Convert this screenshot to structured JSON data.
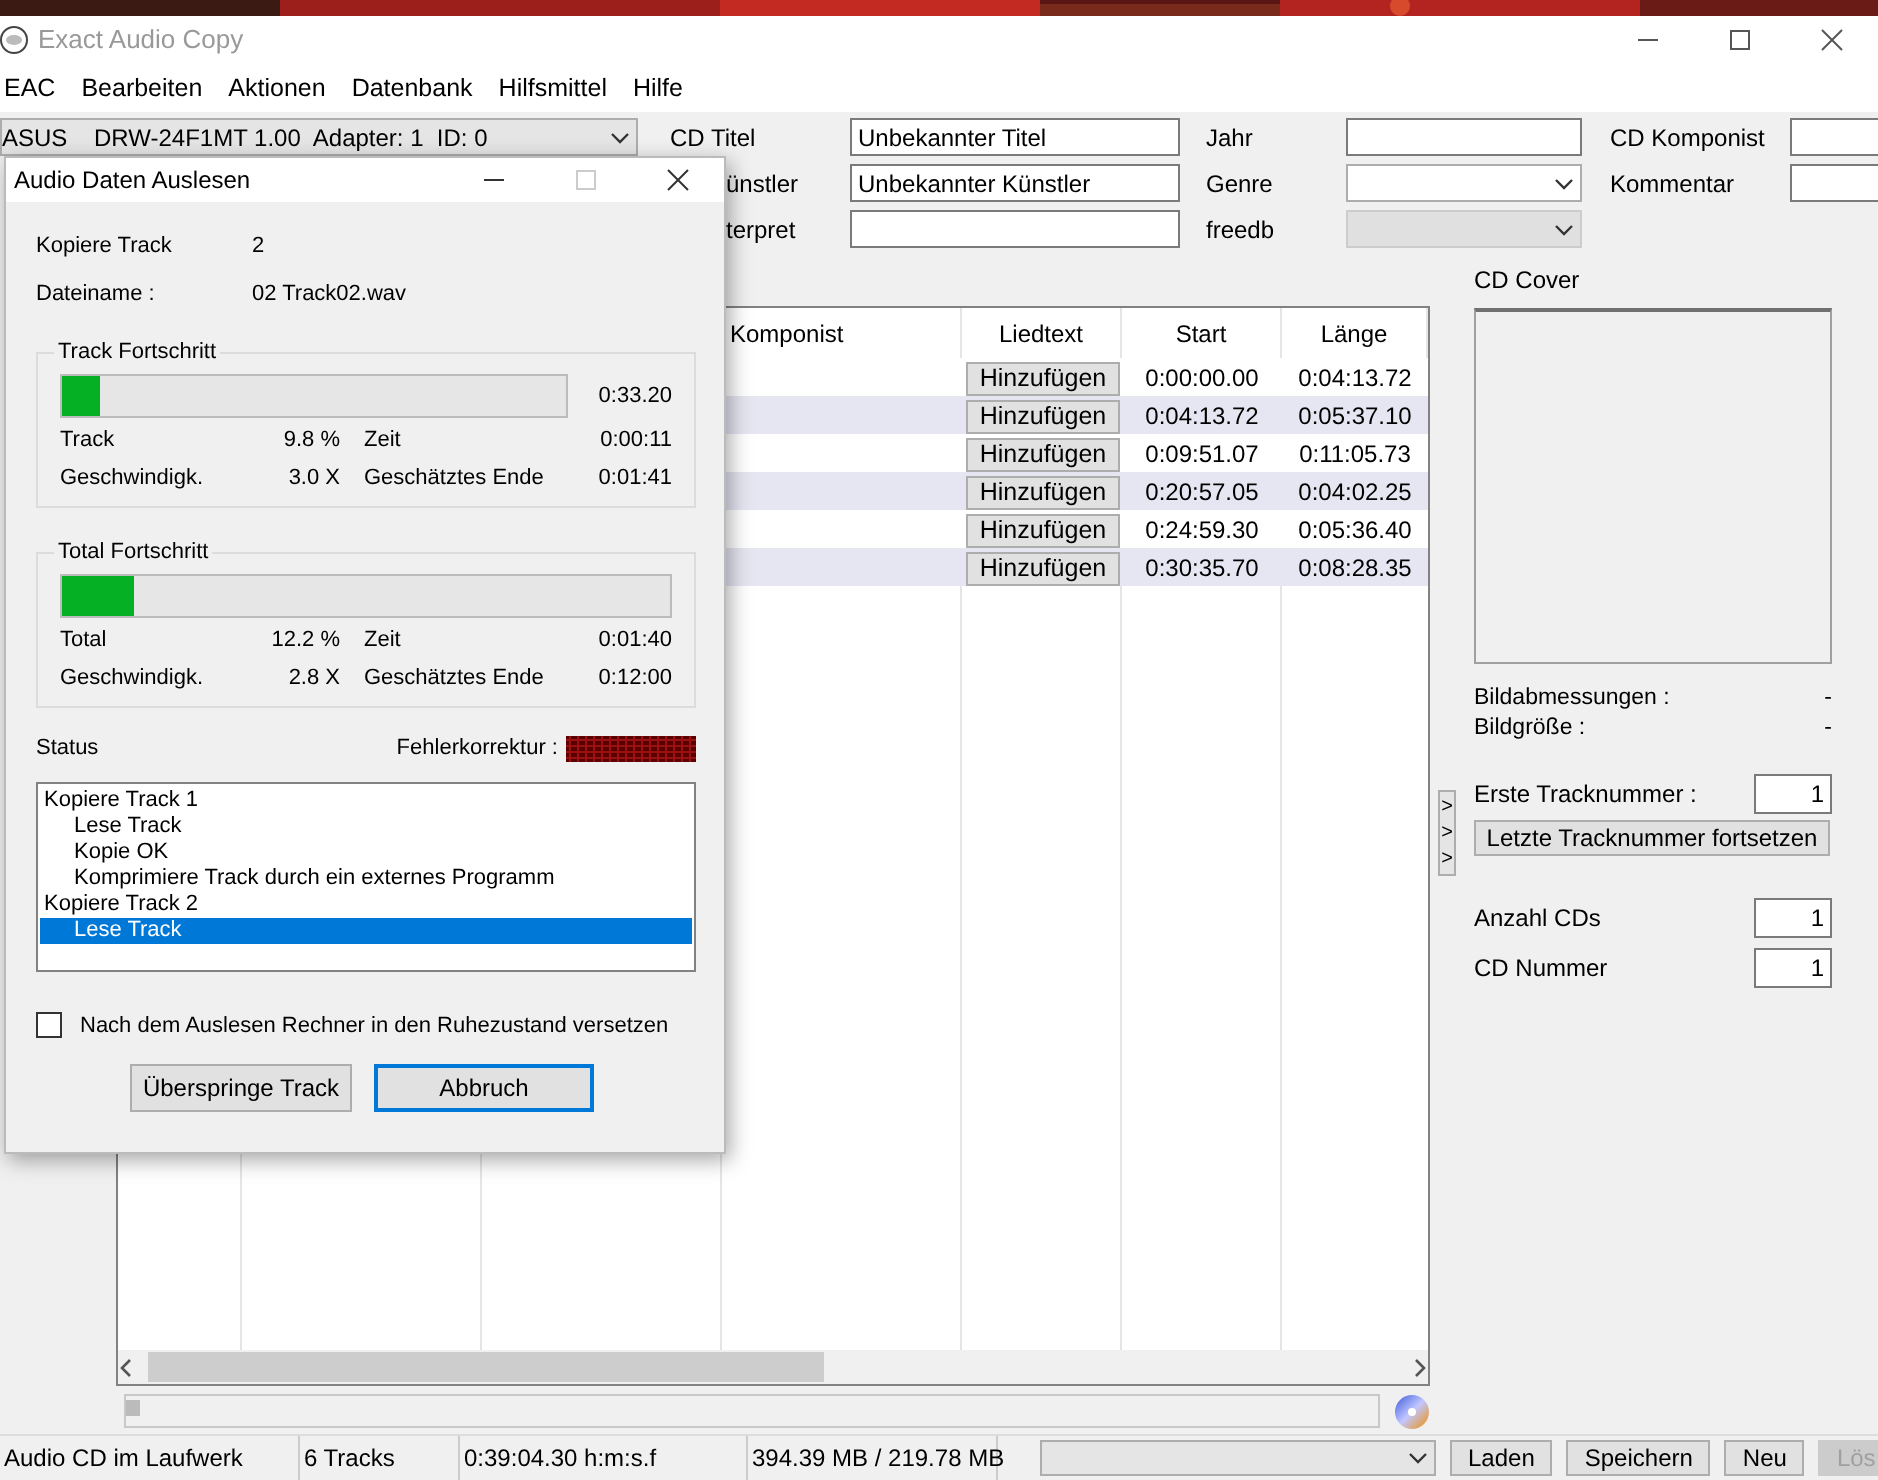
{
  "window": {
    "title": "Exact Audio Copy"
  },
  "menu": [
    "EAC",
    "Bearbeiten",
    "Aktionen",
    "Datenbank",
    "Hilfsmittel",
    "Hilfe"
  ],
  "drive": {
    "value": "ASUS    DRW-24F1MT 1.00  Adapter: 1  ID: 0"
  },
  "cd_fields": [
    [
      {
        "label": "CD Titel",
        "kind": "text",
        "value": "Unbekannter Titel"
      },
      {
        "label": "Jahr",
        "kind": "text"
      },
      {
        "label": "CD Komponist",
        "kind": "text"
      }
    ],
    [
      {
        "label": "ünstler",
        "kind": "text",
        "value": "Unbekannter Künstler"
      },
      {
        "label": "Genre",
        "kind": "combo",
        "disabled": false
      },
      {
        "label": "Kommentar",
        "kind": "text"
      }
    ],
    [
      {
        "label": "terpret",
        "kind": "text"
      },
      {
        "label": "freedb",
        "kind": "combo",
        "disabled": true
      }
    ]
  ],
  "table": {
    "columns": [
      "Komponist",
      "Liedtext",
      "Start",
      "Länge"
    ],
    "rows": [
      {
        "lyrics_button": "Hinzufügen",
        "start": "0:00:00.00",
        "length": "0:04:13.72"
      },
      {
        "lyrics_button": "Hinzufügen",
        "start": "0:04:13.72",
        "length": "0:05:37.10"
      },
      {
        "lyrics_button": "Hinzufügen",
        "start": "0:09:51.07",
        "length": "0:11:05.73"
      },
      {
        "lyrics_button": "Hinzufügen",
        "start": "0:20:57.05",
        "length": "0:04:02.25"
      },
      {
        "lyrics_button": "Hinzufügen",
        "start": "0:24:59.30",
        "length": "0:05:36.40"
      },
      {
        "lyrics_button": "Hinzufügen",
        "start": "0:30:35.70",
        "length": "0:08:28.35"
      }
    ]
  },
  "seek": {
    "level": 0
  },
  "cover": {
    "label": "CD Cover",
    "info": [
      {
        "label": "Bildabmessungen :",
        "value": "-"
      },
      {
        "label": "Bildgröße :",
        "value": "-"
      }
    ]
  },
  "panel_toggle": ">>>",
  "track_numbers": {
    "first_label": "Erste Tracknummer :",
    "first_value": "1",
    "continue_button": "Letzte Tracknummer fortsetzen",
    "count_label": "Anzahl CDs",
    "count_value": "1",
    "number_label": "CD Nummer",
    "number_value": "1"
  },
  "status_bar": {
    "cells": [
      "Audio CD im Laufwerk",
      "6 Tracks",
      "0:39:04.30 h:m:s.f",
      "394.39 MB / 219.78 MB"
    ],
    "buttons": [
      {
        "label": "Laden",
        "disabled": false
      },
      {
        "label": "Speichern",
        "disabled": false
      },
      {
        "label": "Neu",
        "disabled": false
      },
      {
        "label": "Lös",
        "disabled": true
      }
    ]
  },
  "dialog": {
    "title": "Audio Daten Auslesen",
    "info": [
      {
        "label": "Kopiere Track",
        "value": "2"
      },
      {
        "label": "Dateiname :",
        "value": "02 Track02.wav"
      }
    ],
    "groups": [
      {
        "title": "Track Fortschritt",
        "level": 0.075,
        "time": "0:33.20",
        "stats": [
          {
            "label": "Track",
            "value": "9.8 %",
            "label2": "Zeit",
            "value2": "0:00:11"
          },
          {
            "label": "Geschwindigk.",
            "value": "3.0 X",
            "label2": "Geschätztes Ende",
            "value2": "0:01:41"
          }
        ]
      },
      {
        "title": "Total Fortschritt",
        "level": 0.12,
        "stats": [
          {
            "label": "Total",
            "value": "12.2 %",
            "label2": "Zeit",
            "value2": "0:01:40"
          },
          {
            "label": "Geschwindigk.",
            "value": "2.8 X",
            "label2": "Geschätztes Ende",
            "value2": "0:12:00"
          }
        ]
      }
    ],
    "status_label": "Status",
    "error_label": "Fehlerkorrektur :",
    "log": [
      {
        "text": "Kopiere Track  1",
        "selected": false,
        "children": [
          {
            "text": "Lese Track",
            "selected": false
          },
          {
            "text": "Kopie OK",
            "selected": false
          },
          {
            "text": "Komprimiere Track durch ein externes Programm",
            "selected": false
          }
        ]
      },
      {
        "text": "Kopiere Track  2",
        "selected": false,
        "children": [
          {
            "text": "Lese Track",
            "selected": true
          }
        ]
      }
    ],
    "sleep_checkbox": {
      "label": "Nach dem Auslesen Rechner in den Ruhezustand versetzen",
      "checked": false
    },
    "buttons": [
      {
        "label": "Überspringe Track",
        "default": false
      },
      {
        "label": "Abbruch",
        "default": true
      }
    ]
  }
}
